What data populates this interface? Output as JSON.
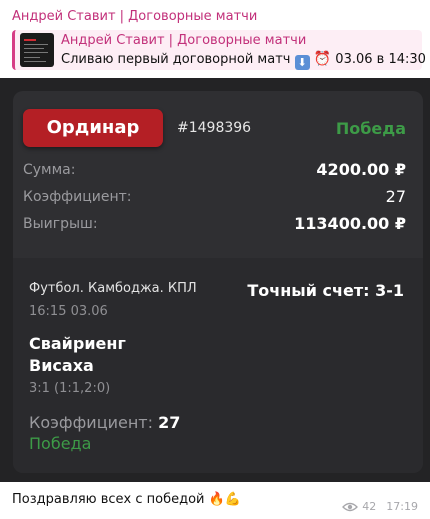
{
  "channel": {
    "sender": "Андрей Ставит | Договорные матчи"
  },
  "reply": {
    "title": "Андрей Ставит | Договорные матчи",
    "text_before": "Сливаю первый договорной матч ",
    "arrow_icon": "down-arrow-emoji",
    "alarm_icon": "alarm-clock-emoji",
    "text_after": " 03.06 в 14:30 ..."
  },
  "bet": {
    "type_label": "Ординар",
    "id": "#1498396",
    "status": "Победа",
    "rows": [
      {
        "label": "Сумма:",
        "value": "4200.00 ₽"
      },
      {
        "label": "Коэффициент:",
        "value": "27"
      },
      {
        "label": "Выигрыш:",
        "value": "113400.00 ₽"
      }
    ],
    "event": {
      "sport_league": "Футбол. Камбоджа. КПЛ",
      "datetime": "16:15 03.06",
      "market": "Точный счет: 3-1",
      "team1": "Свайриенг",
      "team2": "Висаха",
      "score": "3:1 (1:1,2:0)",
      "coef_label": "Коэффициент:",
      "coef_value": "27",
      "result": "Победа"
    }
  },
  "message": {
    "caption": "Поздравляю всех с победой ",
    "emojis": [
      "fire",
      "flexed-biceps"
    ],
    "views": "42",
    "time": "17:19"
  },
  "colors": {
    "win": "#3d9b47",
    "accent": "#b41f25",
    "channel": "#c2307a"
  }
}
